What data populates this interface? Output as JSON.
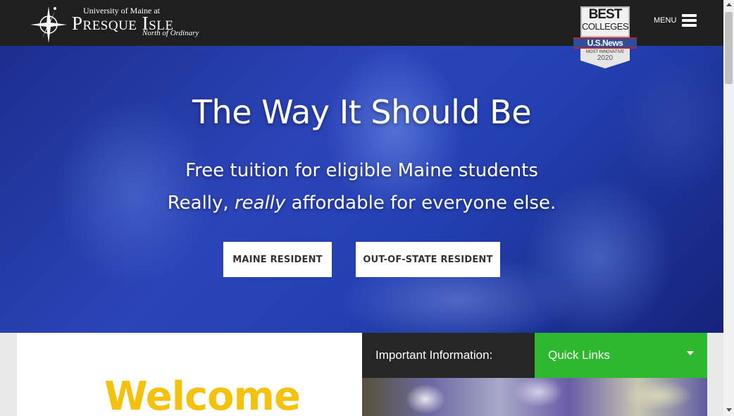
{
  "header": {
    "logo": {
      "top_line": "University of Maine at",
      "main": "Presque Isle",
      "tagline": "North of Ordinary"
    },
    "badge": {
      "line1": "BEST",
      "line2": "COLLEGES",
      "ribbon": "U.S.News",
      "subtitle": "MOST INNOVATIVE",
      "year": "2020"
    },
    "menu_label": "MENU"
  },
  "hero": {
    "headline": "The Way It Should Be",
    "line1": "Free tuition for eligible Maine students",
    "line2_prefix": "Really,",
    "line2_emphasis": "really",
    "line2_suffix": "affordable for everyone else.",
    "buttons": {
      "maine": "MAINE RESIDENT",
      "out_of_state": "OUT-OF-STATE RESIDENT"
    }
  },
  "welcome": {
    "heading": "Welcome"
  },
  "info": {
    "label": "Important Information:",
    "dropdown_selected": "Quick Links"
  },
  "colors": {
    "header_bg": "#1f1f1f",
    "hero_blue": "#2b44b8",
    "welcome_yellow": "#f4c20d",
    "quick_links_green": "#2eb82e",
    "info_dark": "#262626"
  }
}
